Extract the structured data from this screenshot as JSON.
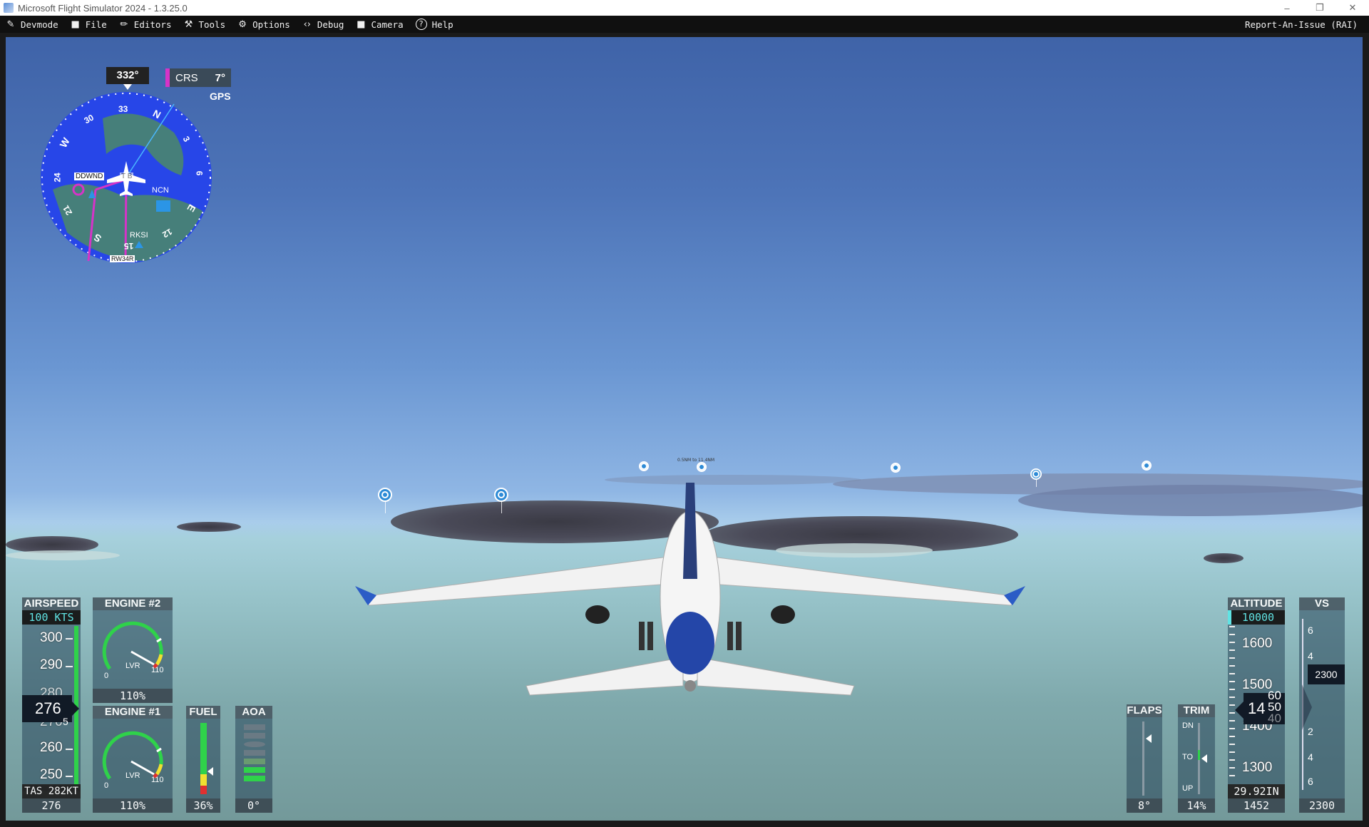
{
  "window": {
    "title": "Microsoft Flight Simulator 2024 - 1.3.25.0",
    "minimize": "–",
    "restore": "❐",
    "close": "✕"
  },
  "menu": {
    "items": [
      {
        "label": "Devmode",
        "icon": "edit-icon",
        "glyph": "✎"
      },
      {
        "label": "File",
        "icon": "folder-icon",
        "glyph": "■"
      },
      {
        "label": "Editors",
        "icon": "pencil-icon",
        "glyph": "✏"
      },
      {
        "label": "Tools",
        "icon": "tools-icon",
        "glyph": "⚒"
      },
      {
        "label": "Options",
        "icon": "gear-icon",
        "glyph": "⚙"
      },
      {
        "label": "Debug",
        "icon": "code-icon",
        "glyph": "‹›"
      },
      {
        "label": "Camera",
        "icon": "camera-icon",
        "glyph": "■"
      },
      {
        "label": "Help",
        "icon": "help-icon",
        "glyph": "?"
      }
    ],
    "report": "Report-An-Issue (RAI)"
  },
  "compass": {
    "heading": "332°",
    "crs_label": "CRS",
    "crs_value": "7°",
    "nav_source": "GPS",
    "cardinal": {
      "n": "N",
      "e": "E",
      "s": "S",
      "w": "W",
      "d33": "33",
      "d30": "30",
      "d24": "24",
      "d21": "21",
      "d15": "15",
      "d12": "12",
      "d6": "6",
      "d3": "3"
    },
    "waypoints": {
      "ddwnd": "DDWND",
      "tb": "T  B",
      "ncn": "NCN",
      "rksi": "RKSI",
      "rw": "RW34R"
    }
  },
  "scenery_tag": "0.5NM to 11.4NM",
  "airspeed": {
    "label": "AIRSPEED",
    "selected": "100 KTS",
    "ticks": [
      "300",
      "290",
      "280",
      "270",
      "260",
      "250"
    ],
    "current": "276",
    "current_small": "5",
    "tas": "TAS 282KT",
    "value": "276"
  },
  "engine2": {
    "label": "ENGINE #2",
    "min": "0",
    "max": "110",
    "lever": "LVR",
    "value": "110%",
    "fraction": 1.0
  },
  "engine1": {
    "label": "ENGINE #1",
    "min": "0",
    "max": "110",
    "lever": "LVR",
    "value": "110%",
    "fraction": 1.0
  },
  "fuel": {
    "label": "FUEL",
    "value": "36%",
    "level": 0.36
  },
  "aoa": {
    "label": "AOA",
    "value": "0°"
  },
  "flaps": {
    "label": "FLAPS",
    "value": "8°",
    "position": 0.2
  },
  "trim": {
    "label": "TRIM",
    "dn": "DN",
    "to": "TO",
    "up": "UP",
    "value": "14%"
  },
  "altitude": {
    "label": "ALTITUDE",
    "selected": "10000",
    "ticks": [
      "1600",
      "1500",
      "1400",
      "1300"
    ],
    "current_big": "14",
    "current_roll": [
      "60",
      "50",
      "40"
    ],
    "baro": "29.92IN",
    "value": "1452"
  },
  "vs": {
    "label": "VS",
    "ticks_top": [
      "6",
      "4"
    ],
    "ticks_bottom": [
      "2",
      "4",
      "6"
    ],
    "selected": "2300",
    "value": "2300"
  },
  "colors": {
    "green": "#2fd24a",
    "cyan": "#5ee6e6",
    "magenta": "#d633c8",
    "compass_blue": "#2746e8"
  }
}
